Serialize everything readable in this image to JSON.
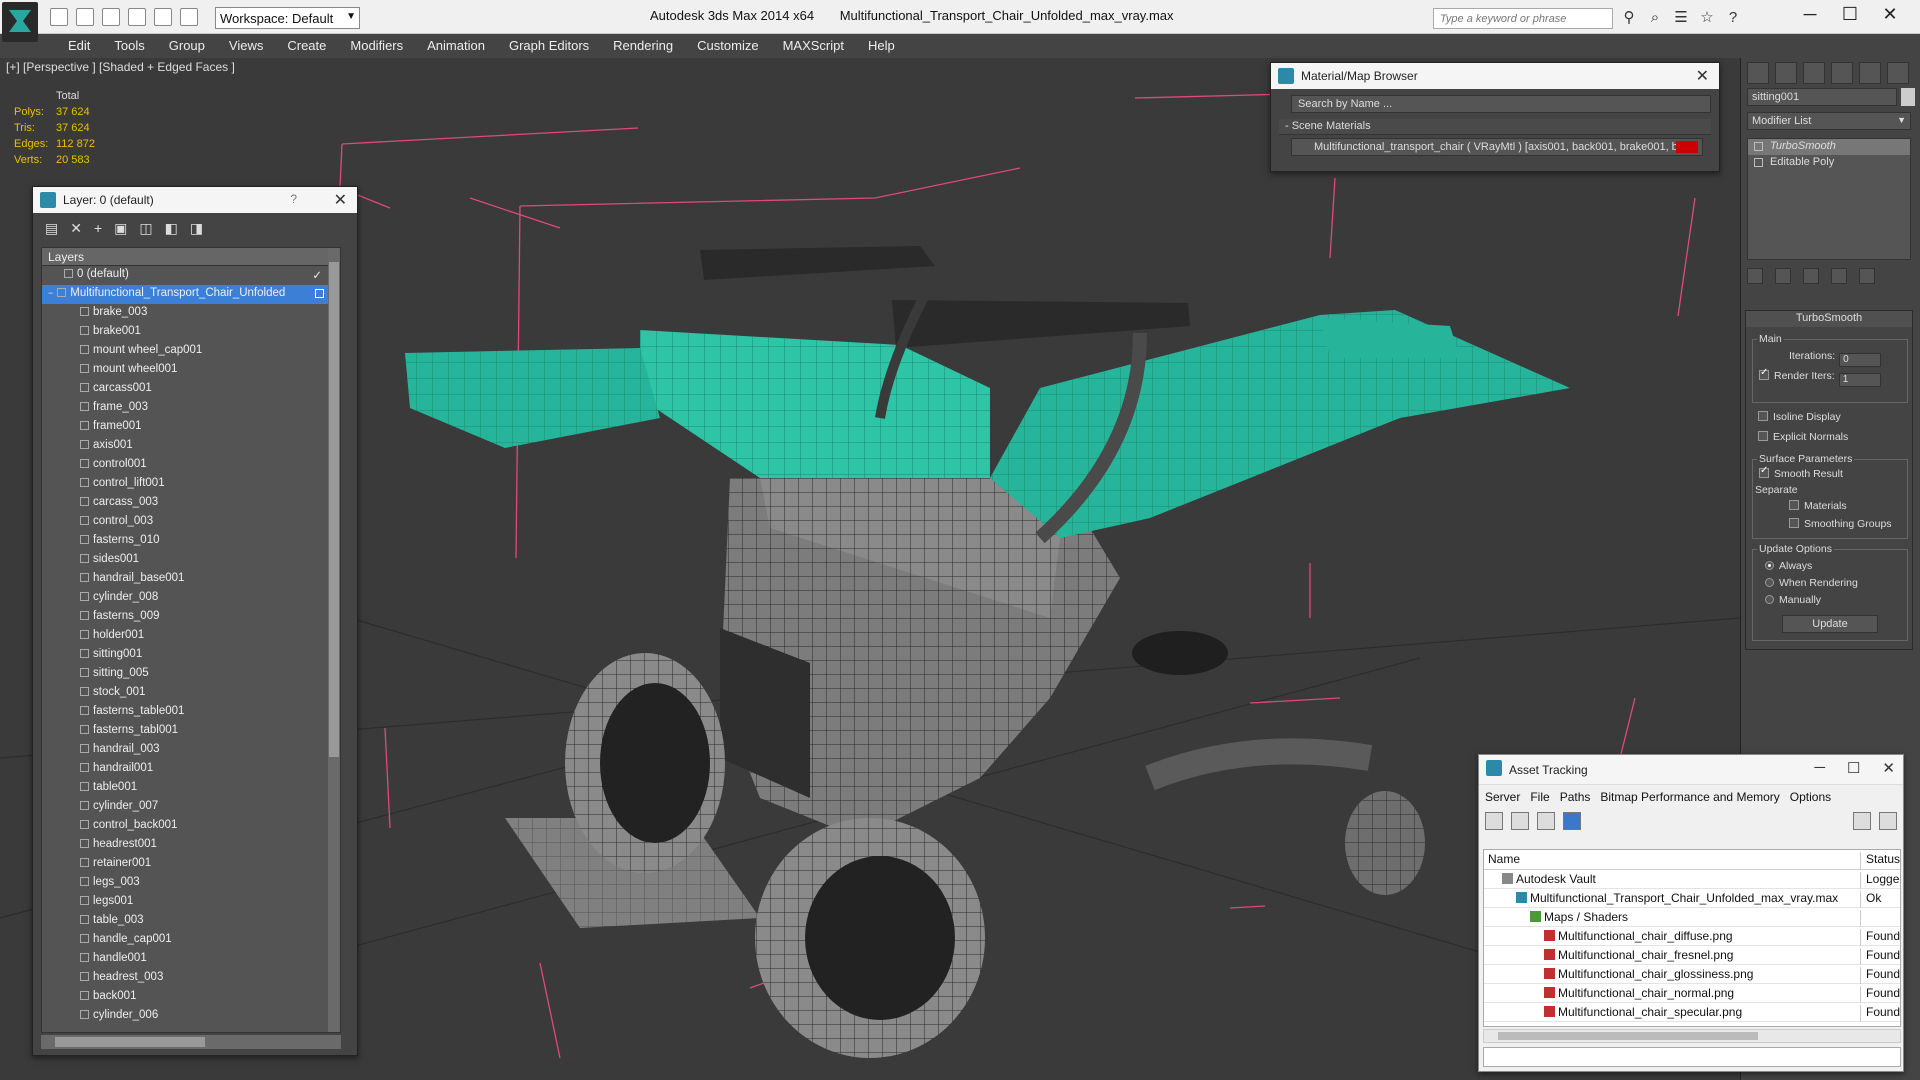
{
  "titlebar": {
    "workspace": "Workspace: Default",
    "app_name": "Autodesk 3ds Max  2014 x64",
    "file_name": "Multifunctional_Transport_Chair_Unfolded_max_vray.max",
    "search_placeholder": "Type a keyword or phrase"
  },
  "menu": [
    "Edit",
    "Tools",
    "Group",
    "Views",
    "Create",
    "Modifiers",
    "Animation",
    "Graph Editors",
    "Rendering",
    "Customize",
    "MAXScript",
    "Help"
  ],
  "viewport": {
    "label": "[+] [Perspective ] [Shaded + Edged Faces ]",
    "stats_total": "Total",
    "stats": [
      {
        "label": "Polys:",
        "value": "37 624"
      },
      {
        "label": "Tris:",
        "value": "37 624"
      },
      {
        "label": "Edges:",
        "value": "112 872"
      },
      {
        "label": "Verts:",
        "value": "20 583"
      }
    ]
  },
  "layer_panel": {
    "title": "Layer: 0 (default)",
    "help": "?",
    "header": "Layers",
    "default_layer": "0 (default)",
    "selected_layer": "Multifunctional_Transport_Chair_Unfolded",
    "objects": [
      "brake_003",
      "brake001",
      "mount wheel_cap001",
      "mount wheel001",
      "carcass001",
      "frame_003",
      "frame001",
      "axis001",
      "control001",
      "control_lift001",
      "carcass_003",
      "control_003",
      "fasterns_010",
      "sides001",
      "handrail_base001",
      "cylinder_008",
      "fasterns_009",
      "holder001",
      "sitting001",
      "sitting_005",
      "stock_001",
      "fasterns_table001",
      "fasterns_tabl001",
      "handrail_003",
      "handrail001",
      "table001",
      "cylinder_007",
      "control_back001",
      "headrest001",
      "retainer001",
      "legs_003",
      "legs001",
      "table_003",
      "handle_cap001",
      "handle001",
      "headrest_003",
      "back001",
      "cylinder_006"
    ]
  },
  "material_browser": {
    "title": "Material/Map Browser",
    "search": "Search by Name ...",
    "section": "- Scene Materials",
    "material": "Multifunctional_transport_chair  ( VRayMtl )  [axis001, back001, brake001, b..."
  },
  "command_panel": {
    "object_name": "sitting001",
    "modifier_list": "Modifier List",
    "stack": [
      "TurboSmooth",
      "Editable Poly"
    ],
    "rollout_title": "TurboSmooth",
    "main_label": "Main",
    "iterations_label": "Iterations:",
    "iterations_value": "0",
    "render_iters_label": "Render Iters:",
    "render_iters_value": "1",
    "isoline": "Isoline Display",
    "explicit_normals": "Explicit Normals",
    "surface_params": "Surface Parameters",
    "smooth_result": "Smooth Result",
    "separate": "Separate",
    "materials": "Materials",
    "smoothing_groups": "Smoothing Groups",
    "update_options": "Update Options",
    "always": "Always",
    "when_rendering": "When Rendering",
    "manually": "Manually",
    "update_button": "Update"
  },
  "asset_tracking": {
    "title": "Asset Tracking",
    "menu": [
      "Server",
      "File",
      "Paths",
      "Bitmap Performance and Memory",
      "Options"
    ],
    "col_name": "Name",
    "col_status": "Status",
    "rows": [
      {
        "name": "Autodesk Vault",
        "status": "Logged",
        "indent": 1
      },
      {
        "name": "Multifunctional_Transport_Chair_Unfolded_max_vray.max",
        "status": "Ok",
        "indent": 2
      },
      {
        "name": "Maps / Shaders",
        "status": "",
        "indent": 3
      },
      {
        "name": "Multifunctional_chair_diffuse.png",
        "status": "Found",
        "indent": 4
      },
      {
        "name": "Multifunctional_chair_fresnel.png",
        "status": "Found",
        "indent": 4
      },
      {
        "name": "Multifunctional_chair_glossiness.png",
        "status": "Found",
        "indent": 4
      },
      {
        "name": "Multifunctional_chair_normal.png",
        "status": "Found",
        "indent": 4
      },
      {
        "name": "Multifunctional_chair_specular.png",
        "status": "Found",
        "indent": 4
      }
    ]
  },
  "colors": {
    "accent_selection": "#3c7fd6",
    "seat_teal": "#26b59a",
    "stats_yellow": "#e7c000",
    "bbox_pink": "#e0487e"
  }
}
